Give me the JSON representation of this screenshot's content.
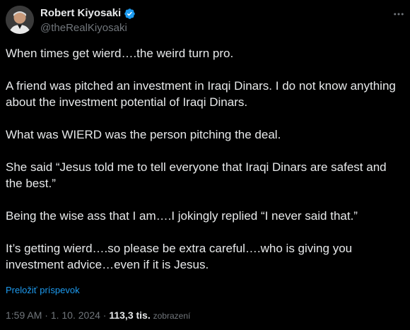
{
  "author": {
    "name": "Robert Kiyosaki",
    "handle": "@theRealKiyosaki",
    "verified_color": "#1d9bf0"
  },
  "icons": {
    "verified": "verified-badge-icon",
    "more": "more-options-icon",
    "avatar": "avatar"
  },
  "tweet": {
    "paragraphs": [
      "When times get wierd….the weird turn pro.",
      "A friend was pitched an investment in Iraqi Dinars.   I do not know anything about the investment potential of Iraqi Dinars.",
      "What was WIERD was the person pitching the deal.",
      "She said “Jesus told me  to tell everyone that Iraqi Dinars are safest and the best.”",
      "Being the wise ass that I am….I jokingly replied “I never said that.”",
      "It’s getting wierd….so please be extra careful….who is giving you investment advice…even if it is Jesus."
    ],
    "translate_label": "Preložiť príspevok",
    "time": "1:59 AM",
    "separator": "·",
    "date": "1. 10. 2024",
    "views_count": "113,3 tis.",
    "views_label": "zobrazení"
  },
  "colors": {
    "background": "#000000",
    "text": "#e7e9ea",
    "muted": "#71767b",
    "link": "#1d9bf0"
  }
}
